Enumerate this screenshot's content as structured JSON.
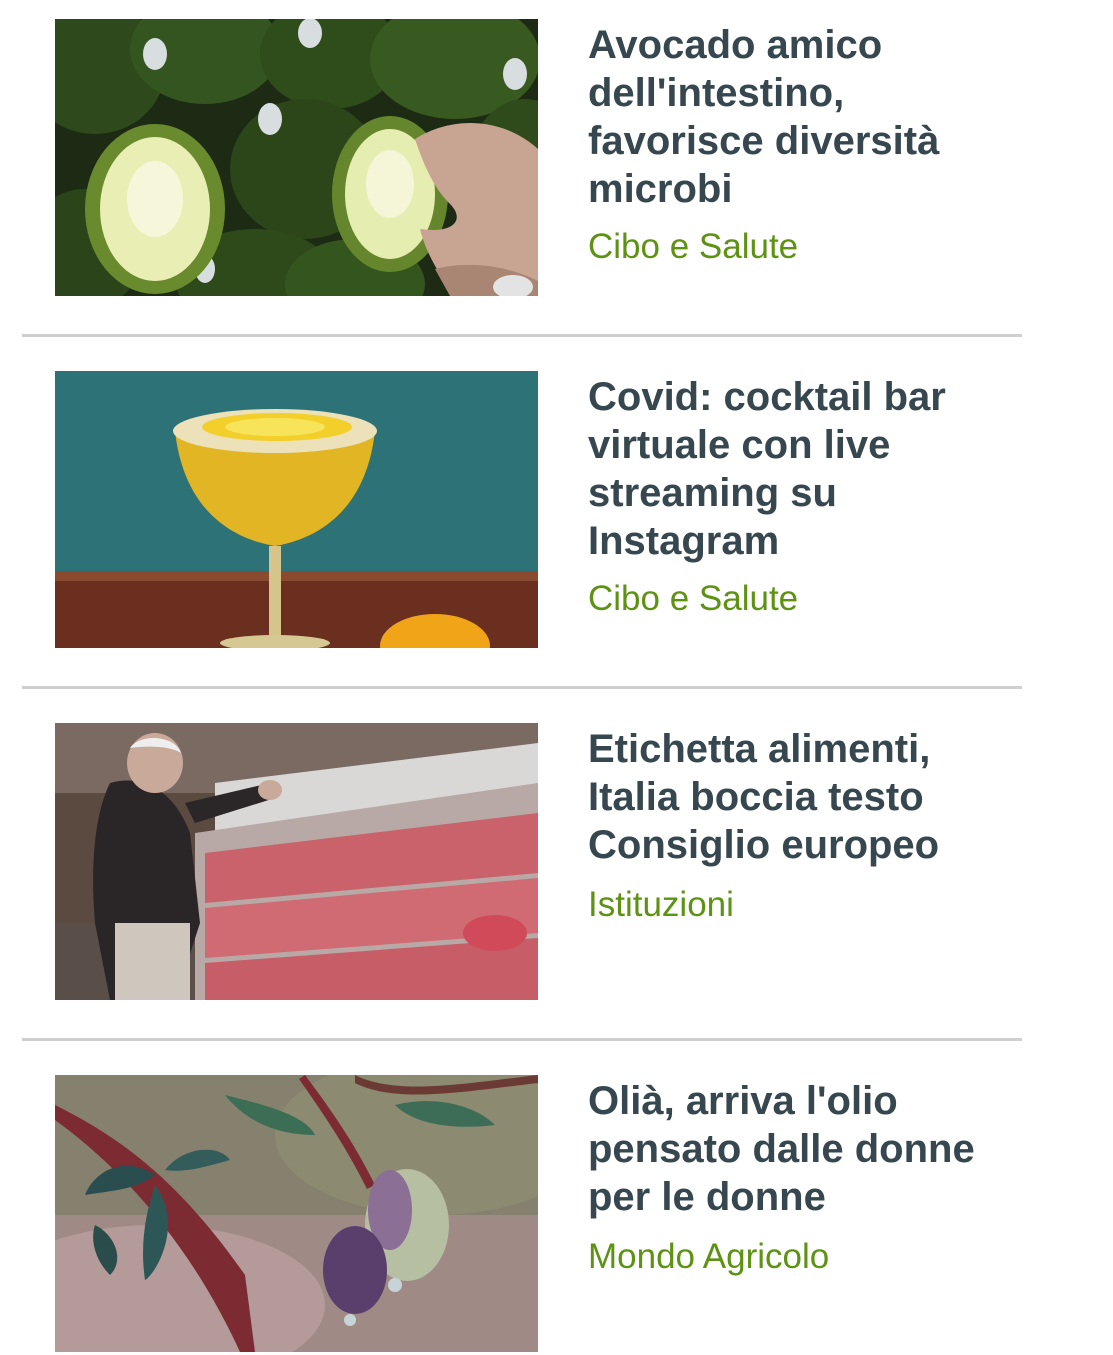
{
  "articles": [
    {
      "title": "Avocado amico dell'intestino, favorisce diversità microbi",
      "category": "Cibo e Salute",
      "image": "avocado-photo"
    },
    {
      "title": "Covid: cocktail bar virtuale con live streaming su Instagram",
      "category": "Cibo e Salute",
      "image": "cocktail-photo"
    },
    {
      "title": "Etichetta alimenti, Italia boccia testo Consiglio europeo",
      "category": "Istituzioni",
      "image": "meat-counter-photo"
    },
    {
      "title": "Olià, arriva l'olio pensato dalle donne per le donne",
      "category": "Mondo Agricolo",
      "image": "olive-branch-photo"
    }
  ],
  "colors": {
    "title": "#37474f",
    "category": "#5d9213",
    "divider": "#cfcfcf"
  }
}
